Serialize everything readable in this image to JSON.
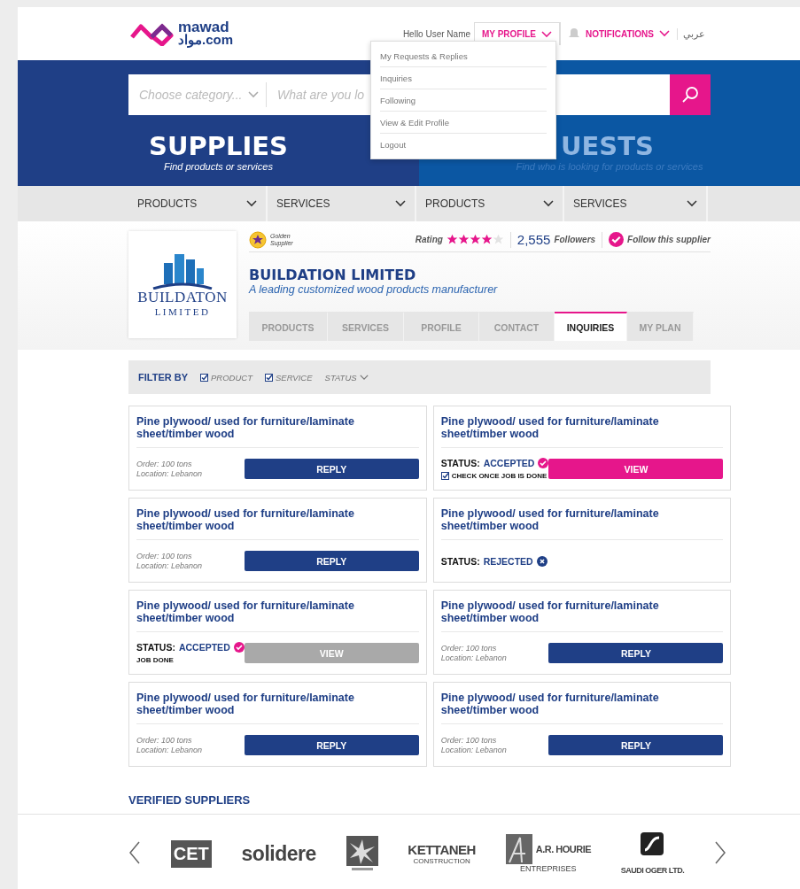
{
  "header": {
    "logo": {
      "line1": "mawad",
      "line2": "مواد.com"
    },
    "greeting": "Hello User Name",
    "profile_menu": {
      "label": "MY PROFILE",
      "expanded": true,
      "items": [
        "My Requests & Replies",
        "Inquiries",
        "Following",
        "View & Edit Profile",
        "Logout"
      ]
    },
    "notifications": {
      "label": "NOTIFICATIONS"
    },
    "language": "عربي"
  },
  "search": {
    "category_placeholder": "Choose category...",
    "query_placeholder": "What are you lo"
  },
  "hero": [
    {
      "title": "SUPPLIES",
      "subtitle": "Find products or services",
      "selected": true
    },
    {
      "title": "UESTS",
      "subtitle": "Find who is looking for products or services",
      "selected": false
    }
  ],
  "category_nav": [
    "PRODUCTS",
    "SERVICES",
    "PRODUCTS",
    "SERVICES"
  ],
  "supplier": {
    "logo_text": {
      "line1": "BUILDATON",
      "line2": "LIMITED"
    },
    "badge": "Golden Supplier",
    "rating_label": "Rating",
    "stars": 4,
    "followers_count": "2,555",
    "followers_label": "Followers",
    "follow": {
      "label": "Follow this supplier",
      "on": true
    },
    "name": "BUILDATION LIMITED",
    "tagline": "A leading customized wood products manufacturer",
    "tabs": [
      {
        "label": "PRODUCTS",
        "selected": false
      },
      {
        "label": "SERVICES",
        "selected": false
      },
      {
        "label": "PROFILE",
        "selected": false
      },
      {
        "label": "CONTACT",
        "selected": false
      },
      {
        "label": "INQUIRIES",
        "selected": true
      },
      {
        "label": "MY PLAN",
        "selected": false
      }
    ]
  },
  "filter": {
    "label": "FILTER BY",
    "options": [
      {
        "label": "PRODUCT",
        "checked": true
      },
      {
        "label": "SERVICE",
        "checked": true
      }
    ],
    "status_dropdown": "STATUS"
  },
  "cards": [
    {
      "kind": "reply",
      "title": "Pine plywood/ used for furniture/laminate sheet/timber wood",
      "order": "Order: 100 tons",
      "location": "Location: Lebanon",
      "button": {
        "label": "REPLY",
        "disabled": false
      }
    },
    {
      "kind": "status",
      "title": "Pine plywood/ used for furniture/laminate sheet/timber wood",
      "status": {
        "label": "STATUS:",
        "value": "ACCEPTED",
        "kind": "accepted"
      },
      "check": {
        "label": "CHECK ONCE JOB IS DONE",
        "checked": true
      },
      "button": {
        "label": "VIEW",
        "disabled": false
      }
    },
    {
      "kind": "reply",
      "title": "Pine plywood/ used for furniture/laminate sheet/timber wood",
      "order": "Order: 100 tons",
      "location": "Location: Lebanon",
      "button": {
        "label": "REPLY",
        "disabled": false
      }
    },
    {
      "kind": "status",
      "title": "Pine plywood/ used for furniture/laminate sheet/timber wood",
      "status": {
        "label": "STATUS:",
        "value": "REJECTED",
        "kind": "rejected"
      }
    },
    {
      "kind": "status",
      "title": "Pine plywood/ used for furniture/laminate sheet/timber wood",
      "status": {
        "label": "STATUS:",
        "value": "ACCEPTED",
        "kind": "accepted"
      },
      "note": "JOB DONE",
      "button": {
        "label": "VIEW",
        "disabled": true
      }
    },
    {
      "kind": "reply",
      "title": "Pine plywood/ used for furniture/laminate sheet/timber wood",
      "order": "Order: 100 tons",
      "location": "Location: Lebanon",
      "button": {
        "label": "REPLY",
        "disabled": false
      }
    },
    {
      "kind": "reply",
      "title": "Pine plywood/ used for furniture/laminate sheet/timber wood",
      "order": "Order: 100 tons",
      "location": "Location: Lebanon",
      "button": {
        "label": "REPLY",
        "disabled": false
      }
    },
    {
      "kind": "reply",
      "title": "Pine plywood/ used for furniture/laminate sheet/timber wood",
      "order": "Order: 100 tons",
      "location": "Location: Lebanon",
      "button": {
        "label": "REPLY",
        "disabled": false
      }
    }
  ],
  "verified": {
    "title": "VERIFIED SUPPLIERS",
    "logos": [
      {
        "kind": "boxed",
        "text": "CET"
      },
      {
        "kind": "wordmark",
        "text": "solidere"
      },
      {
        "kind": "emblem"
      },
      {
        "kind": "wordmark",
        "text": "KETTANEH",
        "sub": "CONSTRUCTION"
      },
      {
        "kind": "mark_text",
        "text": "A.R. HOURIE",
        "sub": "ENTREPRISES"
      },
      {
        "kind": "emblem_text",
        "text": "SAUDI OGER LTD."
      }
    ]
  }
}
